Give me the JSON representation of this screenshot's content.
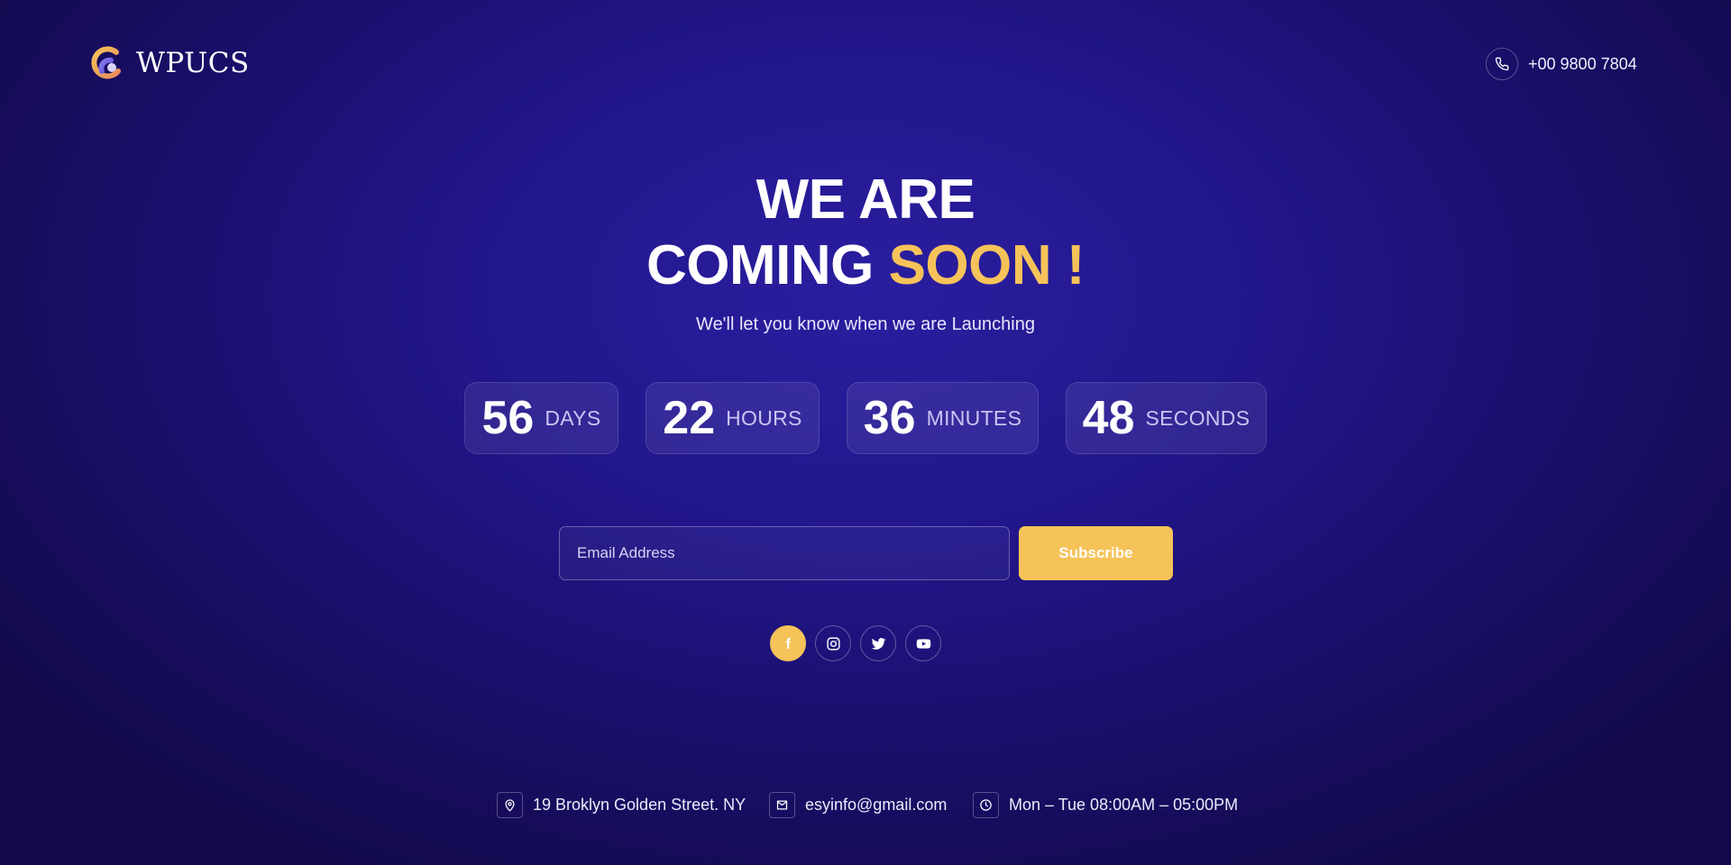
{
  "brand": {
    "name": "WPUCS"
  },
  "header": {
    "phone": "+00 9800 7804"
  },
  "hero": {
    "line1": "WE ARE",
    "line2_white": "COMING",
    "line2_accent": "SOON !",
    "subtitle": "We'll let you know when we are Launching"
  },
  "countdown": [
    {
      "value": "56",
      "unit": "DAYS"
    },
    {
      "value": "22",
      "unit": "HOURS"
    },
    {
      "value": "36",
      "unit": "MINUTES"
    },
    {
      "value": "48",
      "unit": "SECONDS"
    }
  ],
  "subscribe": {
    "placeholder": "Email Address",
    "button": "Subscribe"
  },
  "social": [
    {
      "icon": "facebook-icon",
      "active": true
    },
    {
      "icon": "instagram-icon",
      "active": false
    },
    {
      "icon": "twitter-icon",
      "active": false
    },
    {
      "icon": "youtube-icon",
      "active": false
    }
  ],
  "footer": {
    "address": "19 Broklyn Golden Street. NY",
    "email": "esyinfo@gmail.com",
    "hours": "Mon – Tue 08:00AM – 05:00PM"
  },
  "colors": {
    "accent": "#f6c35a",
    "background": "#22168a",
    "background_dark": "#120a4a"
  }
}
